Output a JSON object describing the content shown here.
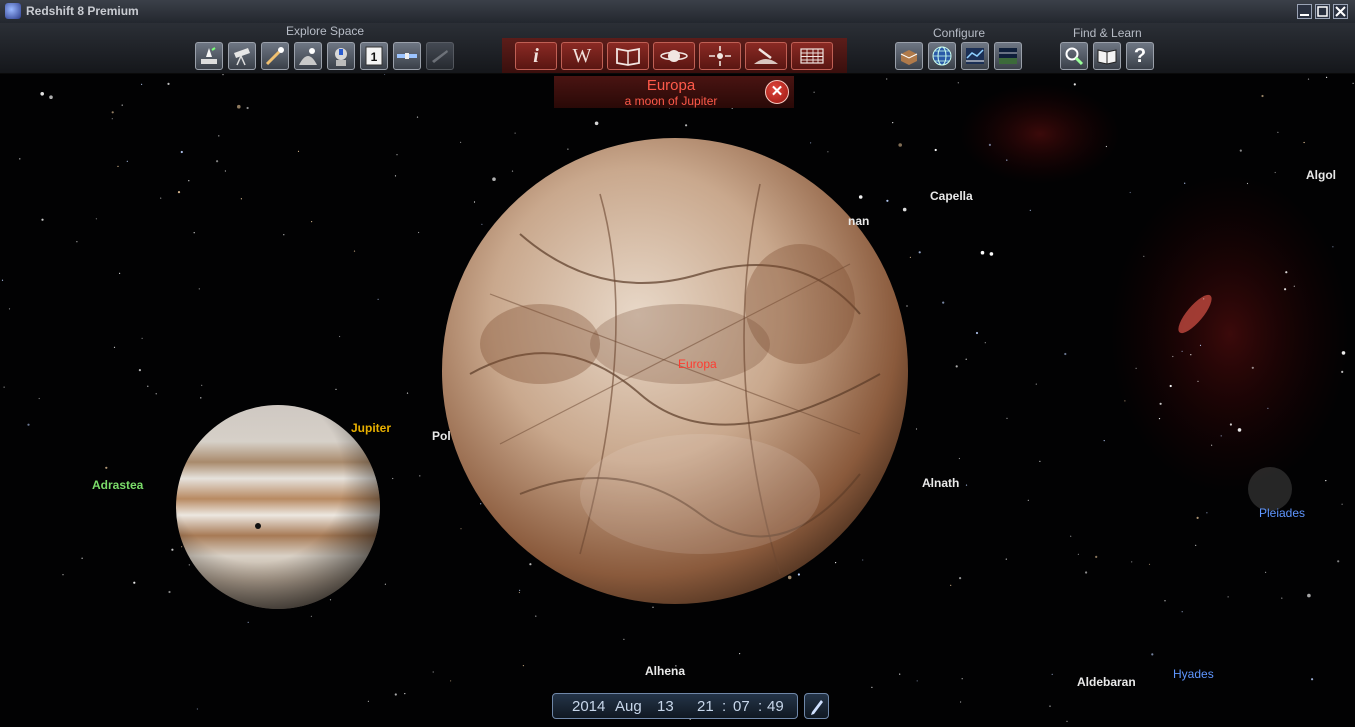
{
  "window": {
    "title": "Redshift 8 Premium",
    "buttons": [
      "minimize",
      "maximize",
      "close"
    ]
  },
  "toolbar": {
    "groups": {
      "explore": "Explore Space",
      "configure": "Configure",
      "find": "Find & Learn"
    },
    "explore_icons": [
      "launch-icon",
      "telescope-icon",
      "comet-icon",
      "planet-surface-icon",
      "astronaut-info-icon",
      "calendar-day-icon",
      "satellite-icon",
      "spacecraft-icon"
    ],
    "explore_day_number": "1",
    "object_icons": [
      "info-icon",
      "wikipedia-icon",
      "book-icon",
      "planet-rings-icon",
      "center-target-icon",
      "landing-icon",
      "data-grid-icon"
    ],
    "object_glyphs": {
      "info": "i",
      "wikipedia": "W"
    },
    "configure_icons": [
      "book-box-icon",
      "globe-grid-icon",
      "sky-settings-icon",
      "horizon-view-icon"
    ],
    "find_icons": [
      "search-icon",
      "open-book-icon",
      "help-icon"
    ],
    "help_glyph": "?"
  },
  "info_panel": {
    "name": "Europa",
    "subtitle": "a moon of Jupiter",
    "close_glyph": "✕"
  },
  "sky": {
    "labels": {
      "europa": "Europa",
      "jupiter": "Jupiter",
      "adrastea": "Adrastea",
      "pol": "Pol",
      "capella": "Capella",
      "nan": "nan",
      "algol": "Algol",
      "alnath": "Alnath",
      "pleiades": "Pleiades",
      "alhena": "Alhena",
      "aldebaran": "Aldebaran",
      "hyades": "Hyades"
    },
    "colors": {
      "europa_label": "#ff3b30",
      "jupiter_label": "#e8b000",
      "moon_label": "#7bdc6a",
      "cluster_label": "#5f96ff",
      "star_label": "#e9e9e9"
    }
  },
  "datetime": {
    "year": "2014",
    "month": "Aug",
    "day": "13",
    "hour": "21",
    "sep1": ":",
    "minute": "07",
    "sep2": ":",
    "second": "49"
  }
}
